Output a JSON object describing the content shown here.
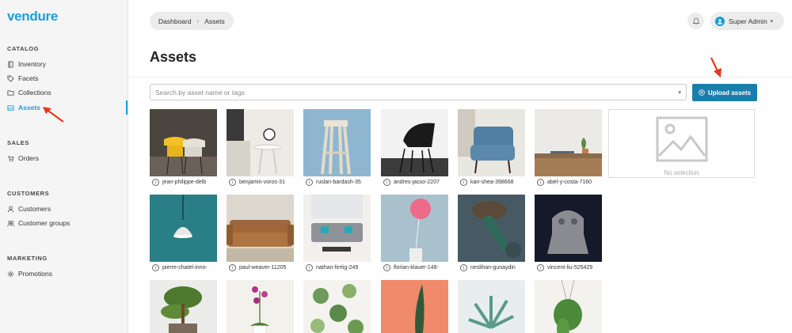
{
  "brand": {
    "name": "vendure"
  },
  "sidebar": {
    "sections": [
      {
        "title": "CATALOG",
        "items": [
          {
            "label": "Inventory",
            "icon": "book-icon"
          },
          {
            "label": "Facets",
            "icon": "tag-icon"
          },
          {
            "label": "Collections",
            "icon": "folder-icon"
          },
          {
            "label": "Assets",
            "icon": "image-icon",
            "active": true
          }
        ]
      },
      {
        "title": "SALES",
        "items": [
          {
            "label": "Orders",
            "icon": "cart-icon"
          }
        ]
      },
      {
        "title": "CUSTOMERS",
        "items": [
          {
            "label": "Customers",
            "icon": "user-icon"
          },
          {
            "label": "Customer groups",
            "icon": "users-icon"
          }
        ]
      },
      {
        "title": "MARKETING",
        "items": [
          {
            "label": "Promotions",
            "icon": "gear-icon"
          }
        ]
      }
    ]
  },
  "header": {
    "breadcrumb": [
      "Dashboard",
      "Assets"
    ],
    "user": "Super Admin"
  },
  "page": {
    "title": "Assets",
    "search_placeholder": "Search by asset name or tags",
    "upload_label": "Upload assets",
    "no_selection": "No selection"
  },
  "assets": [
    {
      "name": "jean-philippe-delb"
    },
    {
      "name": "benjamin-voros-31"
    },
    {
      "name": "ruslan-bardash-35"
    },
    {
      "name": "andres-jasso-2207"
    },
    {
      "name": "kari-shea-398668"
    },
    {
      "name": "abel-y-costa-7160"
    },
    {
      "name": "pierre-chatel-inno-"
    },
    {
      "name": "paul-weaver-11205"
    },
    {
      "name": "nathan-fertig-249"
    },
    {
      "name": "florian-klauer-148-"
    },
    {
      "name": "neslihan-gunaydin"
    },
    {
      "name": "vincent-liu-525429"
    },
    {
      "name": ""
    },
    {
      "name": ""
    },
    {
      "name": ""
    },
    {
      "name": ""
    },
    {
      "name": ""
    },
    {
      "name": ""
    }
  ],
  "colors": {
    "accent": "#1a9dd9",
    "button": "#1a7fa8",
    "annotation": "#e53a1f"
  }
}
